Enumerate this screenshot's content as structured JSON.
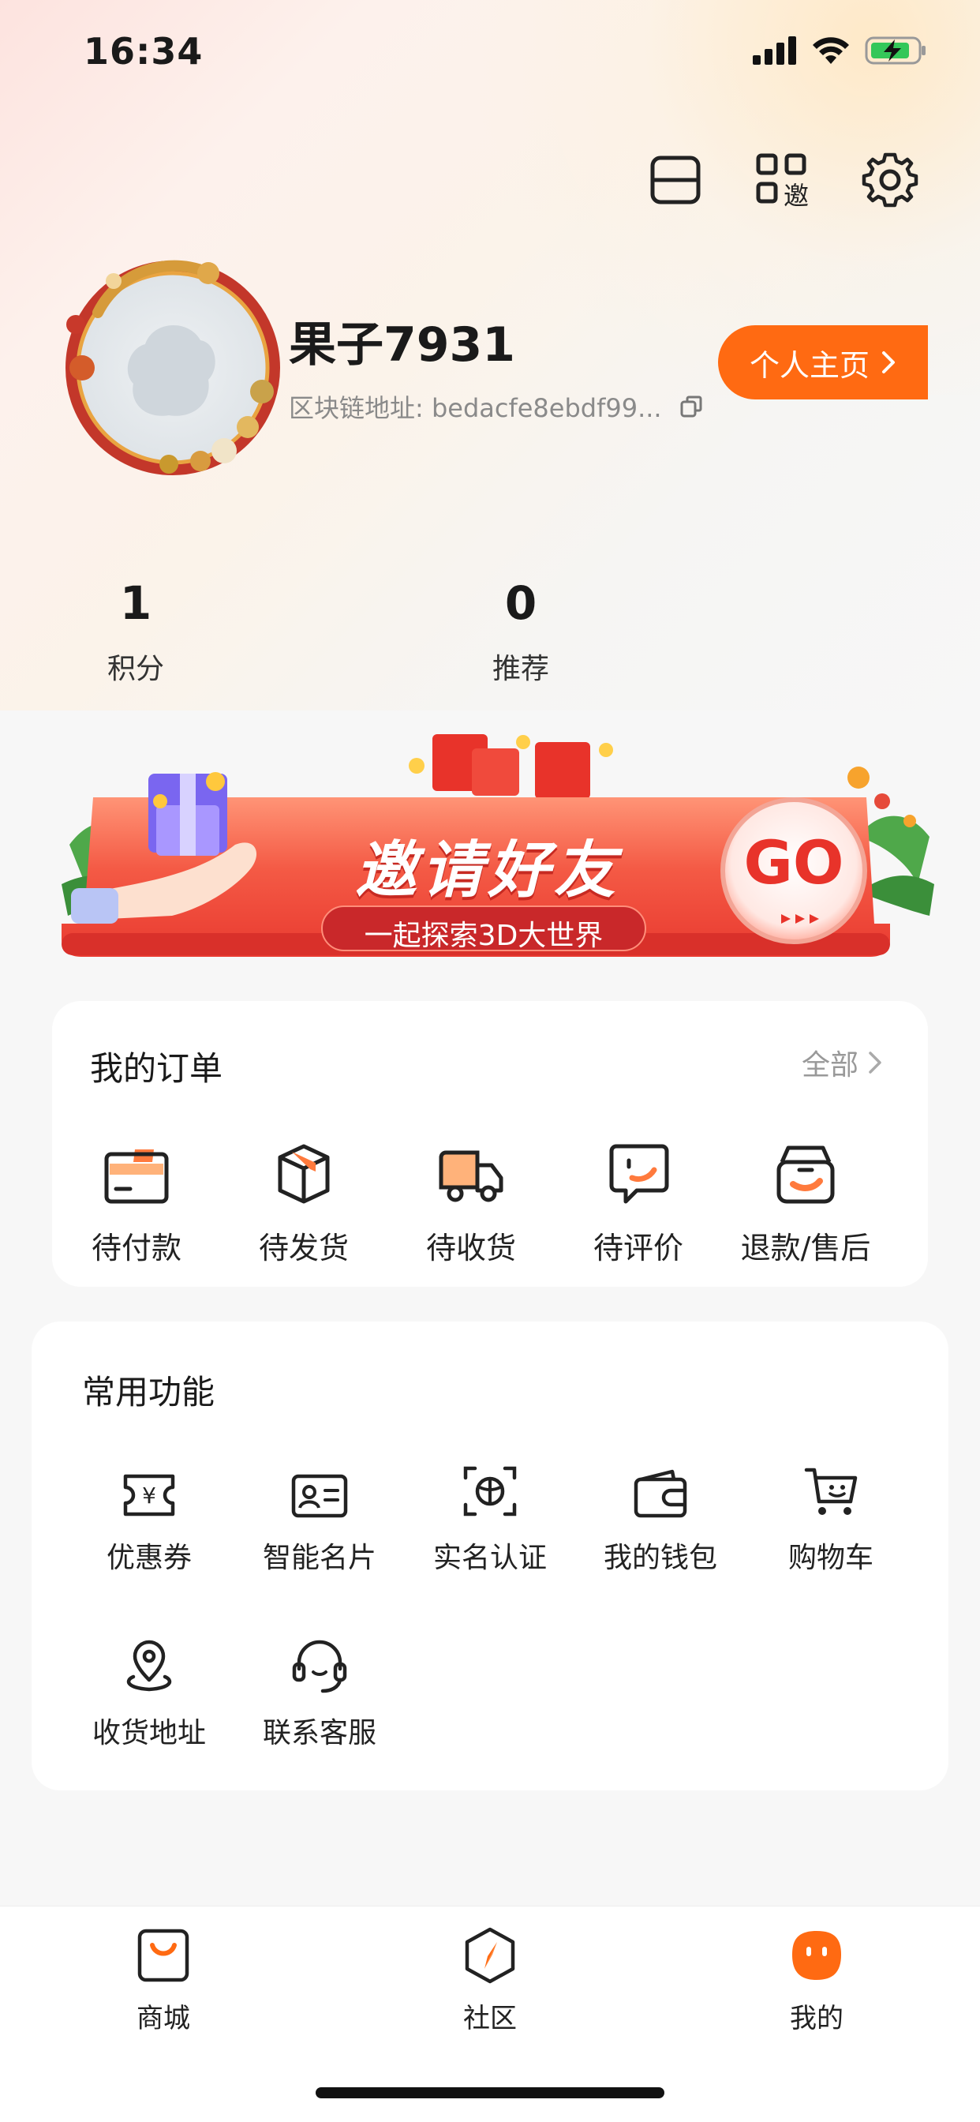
{
  "status_bar": {
    "time": "16:34"
  },
  "profile": {
    "username": "果子7931",
    "chain_address": "区块链地址: bedacfe8ebdf99...",
    "home_button": "个人主页"
  },
  "stats": [
    {
      "value": "1",
      "label": "积分"
    },
    {
      "value": "0",
      "label": "推荐"
    }
  ],
  "banner": {
    "title": "邀请好友",
    "subtitle": "一起探索3D大世界",
    "go": "GO"
  },
  "orders": {
    "title": "我的订单",
    "see_all": "全部",
    "items": [
      {
        "label": "待付款",
        "icon": "card-icon"
      },
      {
        "label": "待发货",
        "icon": "box-icon"
      },
      {
        "label": "待收货",
        "icon": "truck-icon"
      },
      {
        "label": "待评价",
        "icon": "comment-icon"
      },
      {
        "label": "退款/售后",
        "icon": "refund-icon"
      }
    ]
  },
  "functions": {
    "title": "常用功能",
    "items": [
      {
        "label": "优惠券",
        "icon": "coupon-icon"
      },
      {
        "label": "智能名片",
        "icon": "id-card-icon"
      },
      {
        "label": "实名认证",
        "icon": "verify-icon"
      },
      {
        "label": "我的钱包",
        "icon": "wallet-icon"
      },
      {
        "label": "购物车",
        "icon": "cart-icon"
      },
      {
        "label": "收货地址",
        "icon": "location-icon"
      },
      {
        "label": "联系客服",
        "icon": "headset-icon"
      }
    ]
  },
  "nav": [
    {
      "label": "商城",
      "icon": "shop-bag-icon"
    },
    {
      "label": "社区",
      "icon": "compass-icon"
    },
    {
      "label": "我的",
      "icon": "me-icon",
      "active": true
    }
  ],
  "colors": {
    "accent": "#ff6a12",
    "banner_red": "#f04a3c"
  }
}
